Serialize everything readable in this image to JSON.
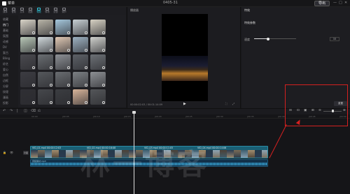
{
  "app": {
    "menu_label": "菜单",
    "project_title": "0405-31",
    "export_label": "导出",
    "win_controls": [
      "—",
      "□",
      "✕"
    ]
  },
  "toolbar": {
    "tools": [
      {
        "label": "媒体",
        "icon": "media-icon",
        "active": false
      },
      {
        "label": "音频",
        "icon": "audio-icon",
        "active": false
      },
      {
        "label": "文本",
        "icon": "text-icon",
        "active": false
      },
      {
        "label": "贴纸",
        "icon": "sticker-icon",
        "active": false
      },
      {
        "label": "特效",
        "icon": "effects-icon",
        "active": true
      },
      {
        "label": "转场",
        "icon": "transition-icon",
        "active": false
      },
      {
        "label": "滤镜",
        "icon": "filter-icon",
        "active": false
      },
      {
        "label": "调节",
        "icon": "adjust-icon",
        "active": false
      }
    ]
  },
  "sidebar": {
    "categories": [
      {
        "label": "收藏",
        "active": false
      },
      {
        "label": "热门",
        "active": true
      },
      {
        "label": "基础",
        "active": false
      },
      {
        "label": "氛围",
        "active": false
      },
      {
        "label": "动感",
        "active": false
      },
      {
        "label": "DV",
        "active": false
      },
      {
        "label": "复古",
        "active": false
      },
      {
        "label": "Bling",
        "active": false
      },
      {
        "label": "综艺",
        "active": false
      },
      {
        "label": "爱心",
        "active": false
      },
      {
        "label": "自然",
        "active": false
      },
      {
        "label": "边框",
        "active": false
      },
      {
        "label": "分屏",
        "active": false
      },
      {
        "label": "纹理",
        "active": false
      },
      {
        "label": "漫画",
        "active": false
      },
      {
        "label": "投影",
        "active": false
      }
    ]
  },
  "library": {
    "thumbs": [
      {
        "bg": "#d9d4c8"
      },
      {
        "bg": "#b9b5a8"
      },
      {
        "bg": "#a6c8dd"
      },
      {
        "bg": "#c7cfd3"
      },
      {
        "bg": "#d7d2c4"
      },
      {
        "bg": "#b8c7b7"
      },
      {
        "bg": "#cfd7da"
      },
      {
        "bg": "#e0c9b5"
      },
      {
        "bg": "#9db1c1"
      },
      {
        "bg": "#cfd0cc"
      },
      {
        "bg": "#4a4a4f"
      },
      {
        "bg": "#6a6e72"
      },
      {
        "bg": "#8d9095"
      },
      {
        "bg": "#5c6066"
      },
      {
        "bg": "#6c7075"
      },
      {
        "bg": "#3c3c42"
      },
      {
        "bg": "#55585c"
      },
      {
        "bg": "#6a6d71"
      },
      {
        "bg": "#7c8084"
      },
      {
        "bg": "#8d9094"
      },
      {
        "bg": "#2f2f34"
      },
      {
        "bg": "#46484c"
      },
      {
        "bg": "#3b3d41"
      },
      {
        "bg": "#d7b49a"
      },
      {
        "bg": "#545659"
      }
    ]
  },
  "player": {
    "title": "播放器",
    "time_current": "00:00:02:03",
    "time_total": "00:01:14:09",
    "play_symbol": "▶",
    "ctl_icons": [
      "⛶",
      "⤢"
    ]
  },
  "inspector": {
    "tab": "特效",
    "subtitle": "特效参数",
    "param_label": "速度",
    "param_value": "33",
    "param_fraction": 0.33,
    "reset_label": "重置"
  },
  "timeline": {
    "tool_icons": [
      "↶",
      "↷",
      "|",
      "◫",
      "⌫",
      "⎌"
    ],
    "ruler_labels": [
      "00:00",
      "|00:05",
      "|00:10",
      "|00:15",
      "|00:20",
      "|00:25",
      "|00:30",
      "|00:35",
      "|00:40",
      "|00:45",
      "|00:50"
    ],
    "cover_label": "封面",
    "track_icons": [
      "🔒",
      "👁"
    ],
    "video_clips": [
      {
        "label": "VID_01.mp4 00:00:12:03"
      },
      {
        "label": "VID_02.mp4 00:00:16:08"
      },
      {
        "label": "VID_03.mp4 00:00:11:05"
      },
      {
        "label": "VID_04.mp4 00:00:14:06"
      }
    ],
    "audio_label": "音频素材.mp3",
    "zoom_icons": [
      "⊟",
      "⊡",
      "▣",
      "⊞",
      "⊖",
      "⊕"
    ]
  },
  "annotation": {
    "color": "#d42020"
  },
  "watermark": {
    "text": "林一博客"
  }
}
